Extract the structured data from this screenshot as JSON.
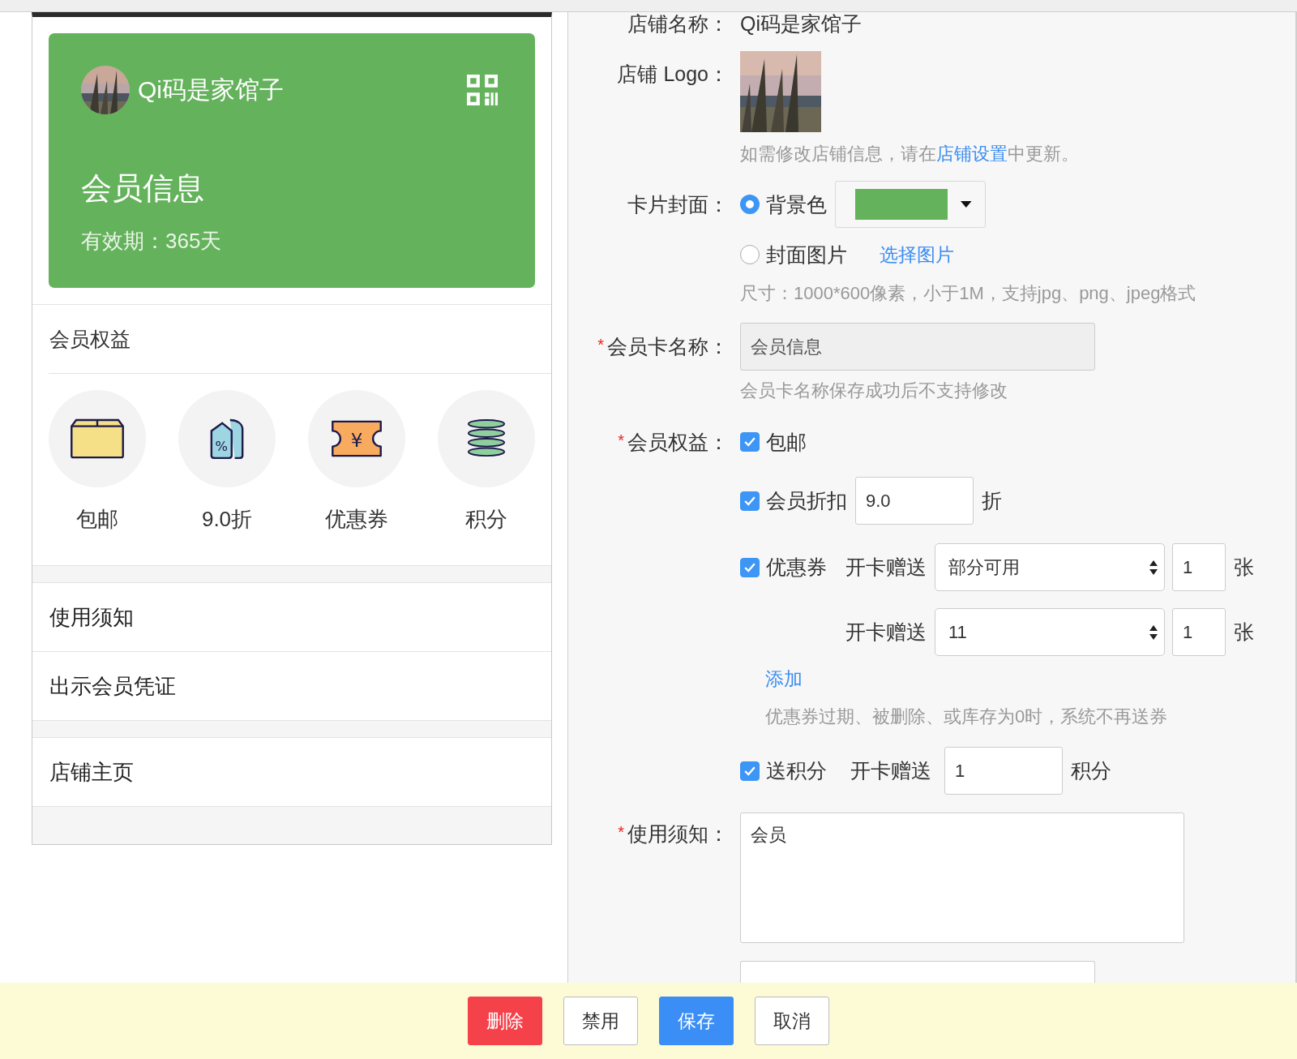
{
  "preview": {
    "store_name": "Qi码是家馆子",
    "card_title": "会员信息",
    "validity": "有效期：365天",
    "benefits_heading": "会员权益",
    "benefits": [
      {
        "kind": "shipping",
        "label": "包邮"
      },
      {
        "kind": "discount",
        "label": "9.0折",
        "icon_text": "%"
      },
      {
        "kind": "coupon",
        "label": "优惠券",
        "icon_text": "¥"
      },
      {
        "kind": "points",
        "label": "积分"
      }
    ],
    "link_groups": [
      [
        "使用须知",
        "出示会员凭证"
      ],
      [
        "店铺主页"
      ]
    ]
  },
  "form": {
    "store_name": {
      "label": "店铺名称：",
      "value": "Qi码是家馆子"
    },
    "logo": {
      "label": "店铺 Logo：",
      "hint_before": "如需修改店铺信息，请在",
      "hint_link": "店铺设置",
      "hint_after": "中更新。"
    },
    "cover": {
      "label": "卡片封面：",
      "options": [
        {
          "kind": "color",
          "label": "背景色",
          "selected": true
        },
        {
          "label": "封面图片",
          "selected": false,
          "link": "选择图片"
        }
      ],
      "hint": "尺寸：1000*600像素，小于1M，支持jpg、png、jpeg格式"
    },
    "card_name": {
      "mark": "*",
      "label": "会员卡名称：",
      "value": "会员信息",
      "disabled": true,
      "hint": "会员卡名称保存成功后不支持修改"
    },
    "benefits": {
      "mark": "*",
      "label": "会员权益：",
      "items": [
        {
          "kind": "plain",
          "label": "包邮",
          "checked": true
        },
        {
          "kind": "discount",
          "label": "会员折扣",
          "checked": true,
          "value": "9.0",
          "unit": "折"
        },
        {
          "kind": "coupon",
          "label": "优惠券",
          "checked": true,
          "rows": [
            {
              "prefix": "开卡赠送",
              "select": "部分可用",
              "qty": "1",
              "unit": "张"
            },
            {
              "prefix": "开卡赠送",
              "select": "11",
              "qty": "1",
              "unit": "张"
            }
          ],
          "add_link": "添加",
          "hint": "优惠券过期、被删除、或库存为0时，系统不再送券"
        },
        {
          "kind": "points",
          "label": "送积分",
          "checked": true,
          "prefix": "开卡赠送",
          "value": "1",
          "unit": "积分"
        }
      ]
    },
    "notice": {
      "mark": "*",
      "label": "使用须知：",
      "value": "会员"
    }
  },
  "footer_buttons": [
    {
      "kind": "danger",
      "label": "删除"
    },
    {
      "kind": "default",
      "label": "禁用"
    },
    {
      "kind": "primary",
      "label": "保存"
    },
    {
      "kind": "default",
      "label": "取消"
    }
  ]
}
